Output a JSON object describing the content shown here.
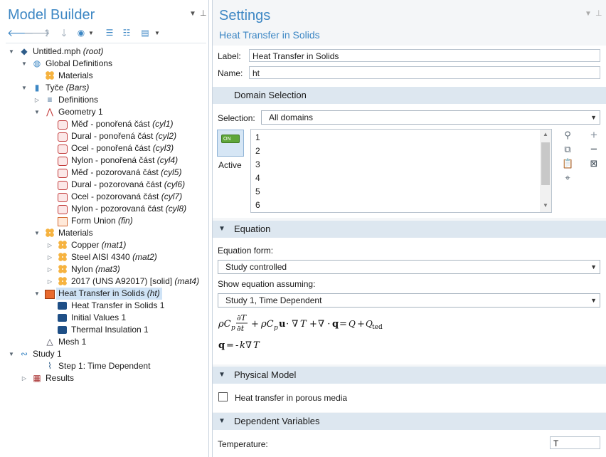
{
  "left": {
    "title": "Model Builder",
    "tree": [
      {
        "label": "Untitled.mph ",
        "em": "(root)"
      },
      {
        "label": "Global Definitions",
        "em": ""
      },
      {
        "label": "Materials",
        "em": ""
      },
      {
        "label": "Tyče ",
        "em": "(Bars)"
      },
      {
        "label": "Definitions",
        "em": ""
      },
      {
        "label": "Geometry 1",
        "em": ""
      },
      {
        "label": "Měď - ponořená část ",
        "em": "(cyl1)"
      },
      {
        "label": "Dural - ponořená část ",
        "em": "(cyl2)"
      },
      {
        "label": "Ocel - ponořená část ",
        "em": "(cyl3)"
      },
      {
        "label": "Nylon - ponořená část ",
        "em": "(cyl4)"
      },
      {
        "label": "Měď - pozorovaná část ",
        "em": "(cyl5)"
      },
      {
        "label": "Dural - pozorovaná část ",
        "em": "(cyl6)"
      },
      {
        "label": "Ocel - pozorovaná část ",
        "em": "(cyl7)"
      },
      {
        "label": "Nylon - pozorovaná část ",
        "em": "(cyl8)"
      },
      {
        "label": "Form Union ",
        "em": "(fin)"
      },
      {
        "label": "Materials",
        "em": ""
      },
      {
        "label": "Copper ",
        "em": "(mat1)"
      },
      {
        "label": "Steel AISI 4340 ",
        "em": "(mat2)"
      },
      {
        "label": "Nylon ",
        "em": "(mat3)"
      },
      {
        "label": "2017 (UNS A92017) [solid] ",
        "em": "(mat4)"
      },
      {
        "label": "Heat Transfer in Solids ",
        "em": "(ht)"
      },
      {
        "label": "Heat Transfer in Solids 1",
        "em": ""
      },
      {
        "label": "Initial Values 1",
        "em": ""
      },
      {
        "label": "Thermal Insulation 1",
        "em": ""
      },
      {
        "label": "Mesh 1",
        "em": ""
      },
      {
        "label": "Study 1",
        "em": ""
      },
      {
        "label": "Step 1: Time Dependent",
        "em": ""
      },
      {
        "label": "Results",
        "em": ""
      }
    ]
  },
  "settings": {
    "title": "Settings",
    "subtitle": "Heat Transfer in Solids",
    "label_caption": "Label:",
    "label_value": "Heat Transfer in Solids",
    "name_caption": "Name:",
    "name_value": "ht",
    "domain_section": "Domain Selection",
    "selection_caption": "Selection:",
    "selection_value": "All domains",
    "active_toggle": "ON",
    "active_caption": "Active",
    "domains": [
      "1",
      "2",
      "3",
      "4",
      "5",
      "6"
    ],
    "equation_section": "Equation",
    "equation_form_caption": "Equation form:",
    "equation_form_value": "Study controlled",
    "show_eq_caption": "Show equation assuming:",
    "show_eq_value": "Study 1, Time Dependent",
    "physical_section": "Physical Model",
    "porous_caption": "Heat transfer in porous media",
    "dependent_section": "Dependent Variables",
    "temperature_caption": "Temperature:",
    "temperature_value": "T"
  }
}
